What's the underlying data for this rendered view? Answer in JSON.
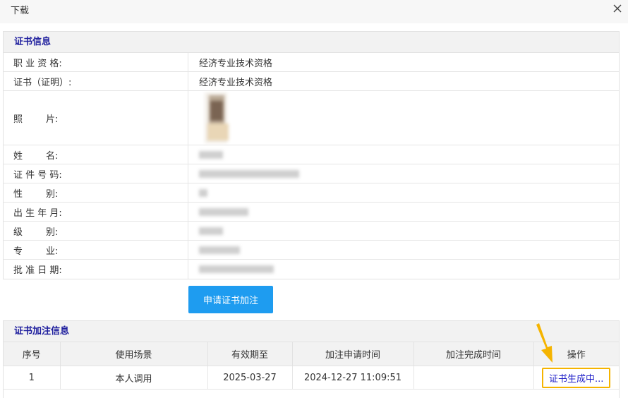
{
  "dialog": {
    "title": "下载",
    "close_icon": "close-icon"
  },
  "certificate": {
    "header": "证书信息",
    "rows": [
      {
        "label": "职 业 资 格:",
        "value": "经济专业技术资格"
      },
      {
        "label": "证书（证明）:",
        "value": "经济专业技术资格"
      },
      {
        "label": "照        片:",
        "value": ""
      },
      {
        "label": "姓        名:",
        "value": ""
      },
      {
        "label": "证 件 号 码:",
        "value": ""
      },
      {
        "label": "性        别:",
        "value": ""
      },
      {
        "label": "出 生 年 月:",
        "value": ""
      },
      {
        "label": "级        别:",
        "value": ""
      },
      {
        "label": "专        业:",
        "value": ""
      },
      {
        "label": "批 准 日 期:",
        "value": ""
      }
    ]
  },
  "apply_button": "申请证书加注",
  "annotation": {
    "header": "证书加注信息",
    "columns": [
      "序号",
      "使用场景",
      "有效期至",
      "加注申请时间",
      "加注完成时间",
      "操作"
    ],
    "rows": [
      {
        "index": "1",
        "scene": "本人调用",
        "valid_until": "2025-03-27",
        "apply_time": "2024-12-27 11:09:51",
        "done_time": "",
        "action": "证书生成中..."
      }
    ]
  },
  "colors": {
    "accent_blue": "#1e9cf0",
    "header_text": "#1f1f9e",
    "highlight": "#f5b400"
  }
}
